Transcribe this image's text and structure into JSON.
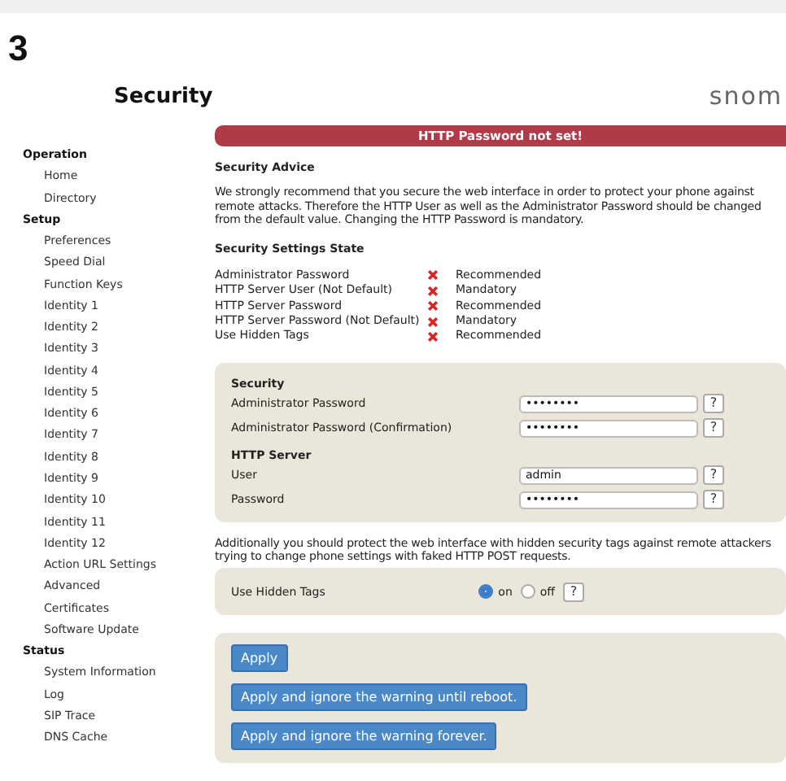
{
  "page_number": "3",
  "page_title": "Security",
  "logo": "snom",
  "sidebar": [
    {
      "heading": "Operation",
      "items": [
        "Home",
        "Directory"
      ]
    },
    {
      "heading": "Setup",
      "items": [
        "Preferences",
        "Speed Dial",
        "Function Keys",
        "Identity 1",
        "Identity 2",
        "Identity 3",
        "Identity 4",
        "Identity 5",
        "Identity 6",
        "Identity 7",
        "Identity 8",
        "Identity 9",
        "Identity 10",
        "Identity 11",
        "Identity 12",
        "Action URL Settings",
        "Advanced",
        "Certificates",
        "Software Update"
      ]
    },
    {
      "heading": "Status",
      "items": [
        "System Information",
        "Log",
        "SIP Trace",
        "DNS Cache"
      ]
    }
  ],
  "alert_banner": "HTTP Password not set!",
  "advice": {
    "heading": "Security Advice",
    "text": "We strongly recommend that you secure the web interface in order to protect your phone against remote attacks. Therefore the HTTP User as well as the Administrator Password should be changed from the default value. Changing the HTTP Password is mandatory."
  },
  "state": {
    "heading": "Security Settings State",
    "rows": [
      {
        "label": "Administrator Password",
        "met": false,
        "requirement": "Recommended"
      },
      {
        "label": "HTTP Server User (Not Default)",
        "met": false,
        "requirement": "Mandatory"
      },
      {
        "label": "HTTP Server Password",
        "met": false,
        "requirement": "Recommended"
      },
      {
        "label": "HTTP Server Password (Not Default)",
        "met": false,
        "requirement": "Mandatory"
      },
      {
        "label": "Use Hidden Tags",
        "met": false,
        "requirement": "Recommended"
      }
    ]
  },
  "form_groups": [
    {
      "heading": "Security",
      "fields": [
        {
          "label": "Administrator Password",
          "value": "••••••••",
          "help": "?"
        },
        {
          "label": "Administrator Password (Confirmation)",
          "value": "••••••••",
          "help": "?"
        }
      ]
    },
    {
      "heading": "HTTP Server",
      "fields": [
        {
          "label": "User",
          "value": "admin",
          "help": "?"
        },
        {
          "label": "Password",
          "value": "••••••••",
          "help": "?"
        }
      ]
    }
  ],
  "hidden_tags_text": "Additionally you should protect the web interface with hidden security tags against remote attackers trying to change phone settings with faked HTTP POST requests.",
  "hidden_tags": {
    "label": "Use Hidden Tags",
    "options": [
      {
        "label": "on",
        "selected": true
      },
      {
        "label": "off",
        "selected": false
      }
    ],
    "help": "?"
  },
  "buttons": [
    "Apply",
    "Apply and ignore the warning until reboot.",
    "Apply and ignore the warning forever."
  ]
}
